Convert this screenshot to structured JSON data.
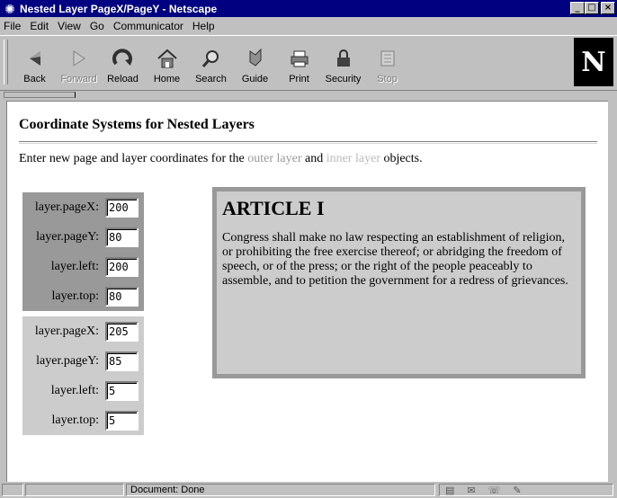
{
  "window": {
    "title": "Nested Layer PageX/PageY - Netscape",
    "controls": {
      "minimize": "_",
      "maximize": "□",
      "close": "×"
    }
  },
  "menubar": {
    "items": [
      {
        "label": "File",
        "accel": "F"
      },
      {
        "label": "Edit",
        "accel": "E"
      },
      {
        "label": "View",
        "accel": "V"
      },
      {
        "label": "Go",
        "accel": "G"
      },
      {
        "label": "Communicator",
        "accel": "C"
      },
      {
        "label": "Help",
        "accel": "H"
      }
    ]
  },
  "toolbar": {
    "buttons": [
      {
        "label": "Back",
        "icon": "back-arrow-icon",
        "enabled": true
      },
      {
        "label": "Forward",
        "icon": "forward-arrow-icon",
        "enabled": false
      },
      {
        "label": "Reload",
        "icon": "reload-icon",
        "enabled": true
      },
      {
        "label": "Home",
        "icon": "home-icon",
        "enabled": true
      },
      {
        "label": "Search",
        "icon": "search-icon",
        "enabled": true
      },
      {
        "label": "Guide",
        "icon": "guide-icon",
        "enabled": true
      },
      {
        "label": "Print",
        "icon": "print-icon",
        "enabled": true
      },
      {
        "label": "Security",
        "icon": "lock-icon",
        "enabled": true
      },
      {
        "label": "Stop",
        "icon": "stop-icon",
        "enabled": false
      }
    ],
    "logo": "N"
  },
  "page": {
    "title": "Coordinate Systems for Nested Layers",
    "intro_before": "Enter new page and layer coordinates for the ",
    "outer_link": "outer layer",
    "intro_middle": " and ",
    "inner_link": "inner layer",
    "intro_after": " objects.",
    "colors": {
      "outer": "#999999",
      "inner": "#cccccc"
    },
    "fields": [
      {
        "label": "layer.pageX:",
        "value": "200",
        "group": "outer"
      },
      {
        "label": "layer.pageY:",
        "value": "80",
        "group": "outer"
      },
      {
        "label": "layer.left:",
        "value": "200",
        "group": "outer"
      },
      {
        "label": "layer.top:",
        "value": "80",
        "group": "outer"
      },
      {
        "label": "layer.pageX:",
        "value": "205",
        "group": "inner"
      },
      {
        "label": "layer.pageY:",
        "value": "85",
        "group": "inner"
      },
      {
        "label": "layer.left:",
        "value": "5",
        "group": "inner"
      },
      {
        "label": "layer.top:",
        "value": "5",
        "group": "inner"
      }
    ],
    "article": {
      "heading": "ARTICLE I",
      "body": "Congress shall make no law respecting an establishment of religion, or prohibiting the free exercise thereof; or abridging the freedom of speech, or of the press; or the right of the people peaceably to assemble, and to petition the government for a redress of grievances."
    }
  },
  "status": {
    "text": "Document: Done"
  }
}
